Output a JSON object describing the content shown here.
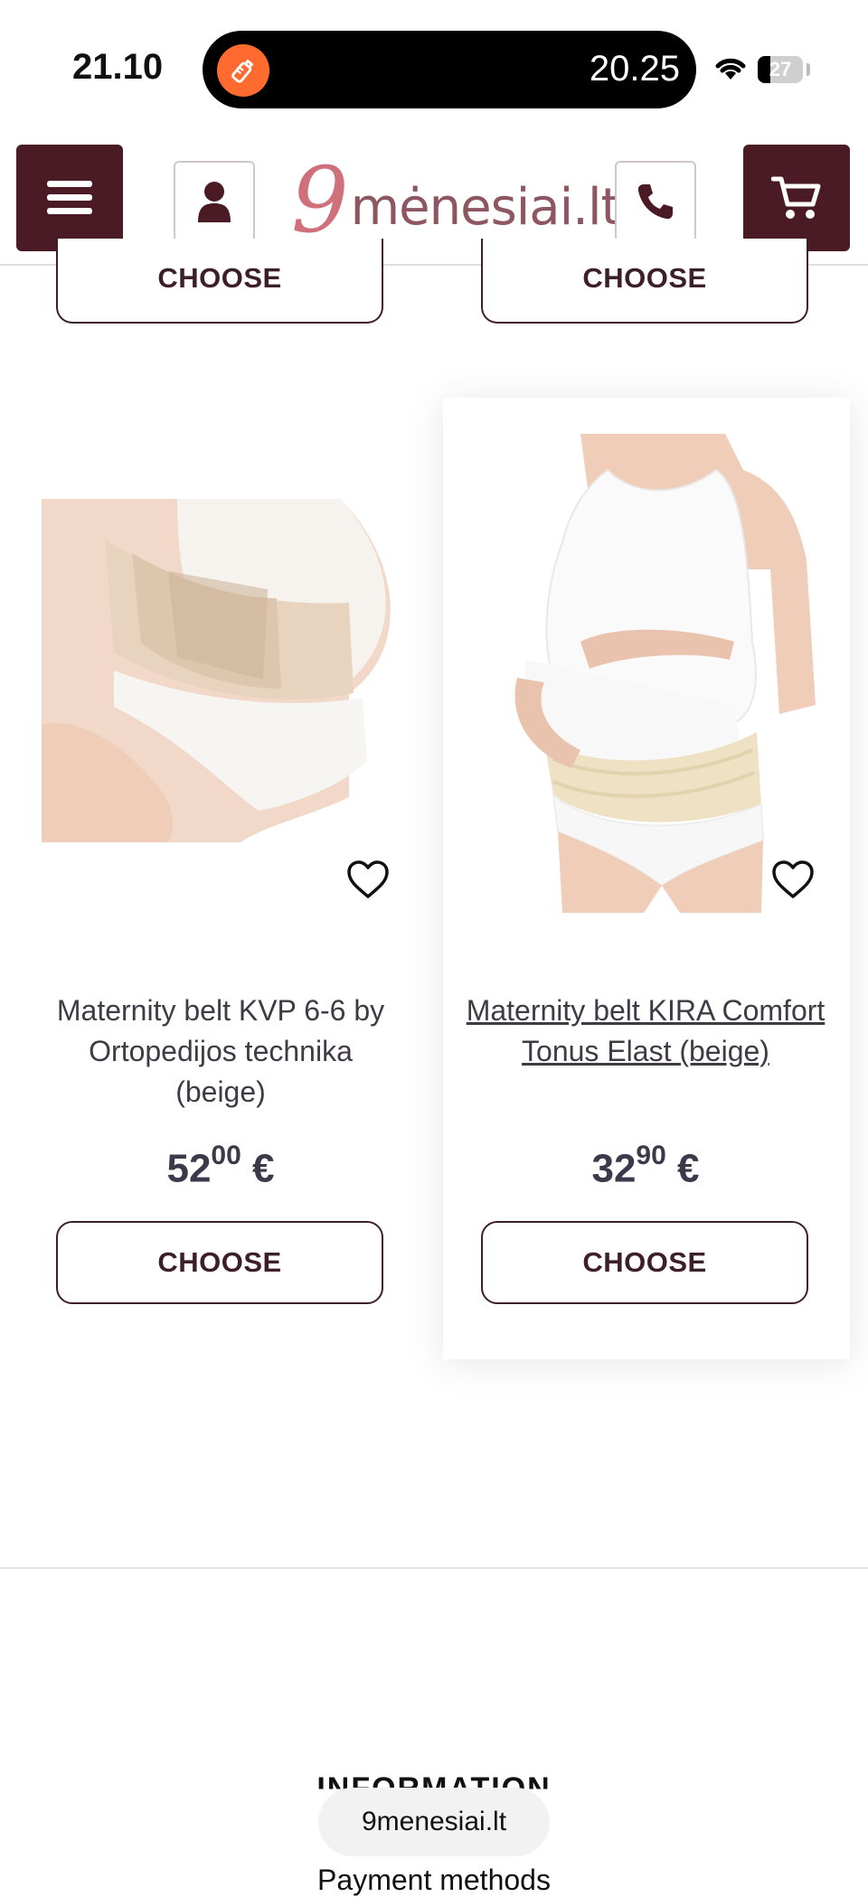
{
  "status_bar": {
    "time": "21.10",
    "pill_time": "20.25",
    "battery": "27"
  },
  "header": {
    "logo_nine": "9",
    "logo_text": "mėnesiai.lt"
  },
  "products_top": [
    {
      "button": "CHOOSE"
    },
    {
      "button": "CHOOSE"
    }
  ],
  "products": [
    {
      "name": "Maternity belt KVP 6-6 by Ortopedijos technika (beige)",
      "price_int": "52",
      "price_dec": "00",
      "currency": "€",
      "button": "CHOOSE"
    },
    {
      "name": "Maternity belt KIRA Comfort Tonus Elast (beige)",
      "price_int": "32",
      "price_dec": "90",
      "currency": "€",
      "button": "CHOOSE"
    }
  ],
  "footer": {
    "info_heading": "INFORMATION",
    "payment_methods": "Payment methods"
  },
  "browser": {
    "url": "9menesiai.lt"
  },
  "colors": {
    "brand": "#4a1b25",
    "logo_pink": "#d0707a",
    "button_border": "#3d1f27",
    "pill_icon": "#ff6a2e"
  }
}
